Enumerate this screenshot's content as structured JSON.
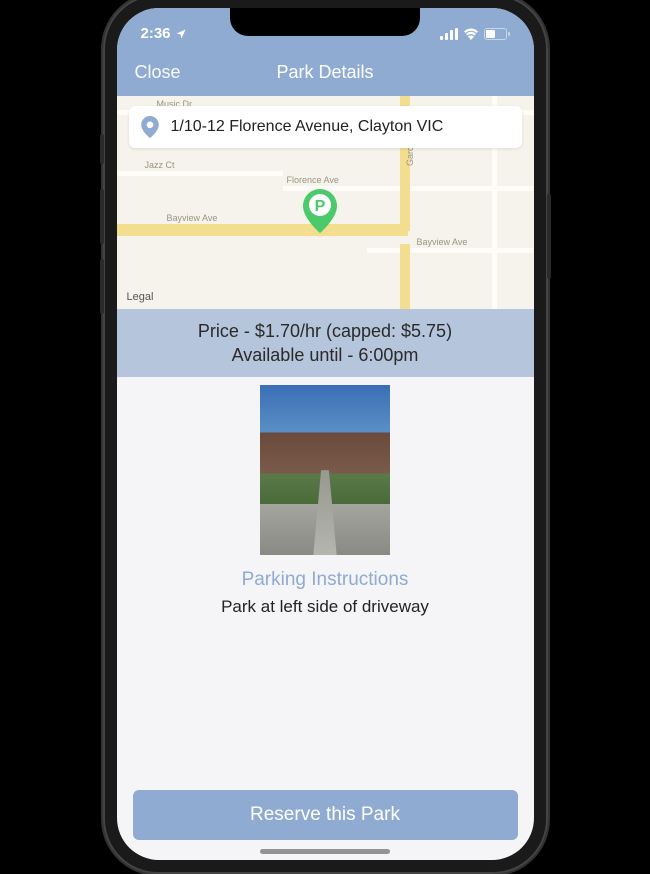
{
  "status": {
    "time": "2:36",
    "location_icon": "▸"
  },
  "nav": {
    "close": "Close",
    "title": "Park Details"
  },
  "map": {
    "address": "1/10-12 Florence Avenue, Clayton VIC",
    "legal": "Legal",
    "streets": {
      "music": "Music Dr",
      "jazz": "Jazz Ct",
      "florence": "Florence Ave",
      "bayview": "Bayview Ave",
      "bayview2": "Bayview Ave",
      "gard": "Gard"
    }
  },
  "pricing": {
    "price_line": "Price - $1.70/hr (capped: $5.75)",
    "availability_line": "Available until - 6:00pm"
  },
  "instructions": {
    "title": "Parking Instructions",
    "text": "Park at left side of driveway"
  },
  "reserve_button": "Reserve this Park"
}
